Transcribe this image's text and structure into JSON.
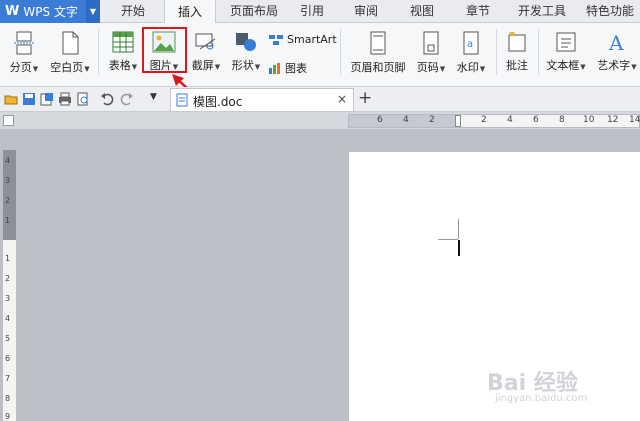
{
  "app": {
    "logo": "W",
    "title": "WPS 文字"
  },
  "menu_tabs": [
    {
      "label": "开始"
    },
    {
      "label": "插入",
      "active": true
    },
    {
      "label": "页面布局"
    },
    {
      "label": "引用"
    },
    {
      "label": "审阅"
    },
    {
      "label": "视图"
    },
    {
      "label": "章节"
    },
    {
      "label": "开发工具"
    },
    {
      "label": "特色功能"
    }
  ],
  "ribbon": {
    "page_break": "分页",
    "blank_page": "空白页",
    "table": "表格",
    "picture": "图片",
    "screenshot": "截屏",
    "shapes": "形状",
    "smartart": "SmartArt",
    "chart": "图表",
    "header_footer": "页眉和页脚",
    "page_number": "页码",
    "watermark": "水印",
    "comment": "批注",
    "textbox": "文本框",
    "wordart": "艺术字"
  },
  "doc_tab": {
    "name": "模图.doc",
    "close": "×"
  },
  "new_tab": "+",
  "hruler_ticks": [
    "6",
    "4",
    "2",
    "2",
    "4",
    "6",
    "8",
    "10",
    "12",
    "14"
  ],
  "vruler_ticks": [
    "4",
    "3",
    "2",
    "1",
    "1",
    "2",
    "3",
    "4",
    "5",
    "6",
    "7",
    "8",
    "9"
  ],
  "watermark": {
    "main": "Bai 经验",
    "sub": "jingyan.baidu.com"
  },
  "colors": {
    "accent": "#3a7cd6",
    "highlight": "#d9191e"
  }
}
